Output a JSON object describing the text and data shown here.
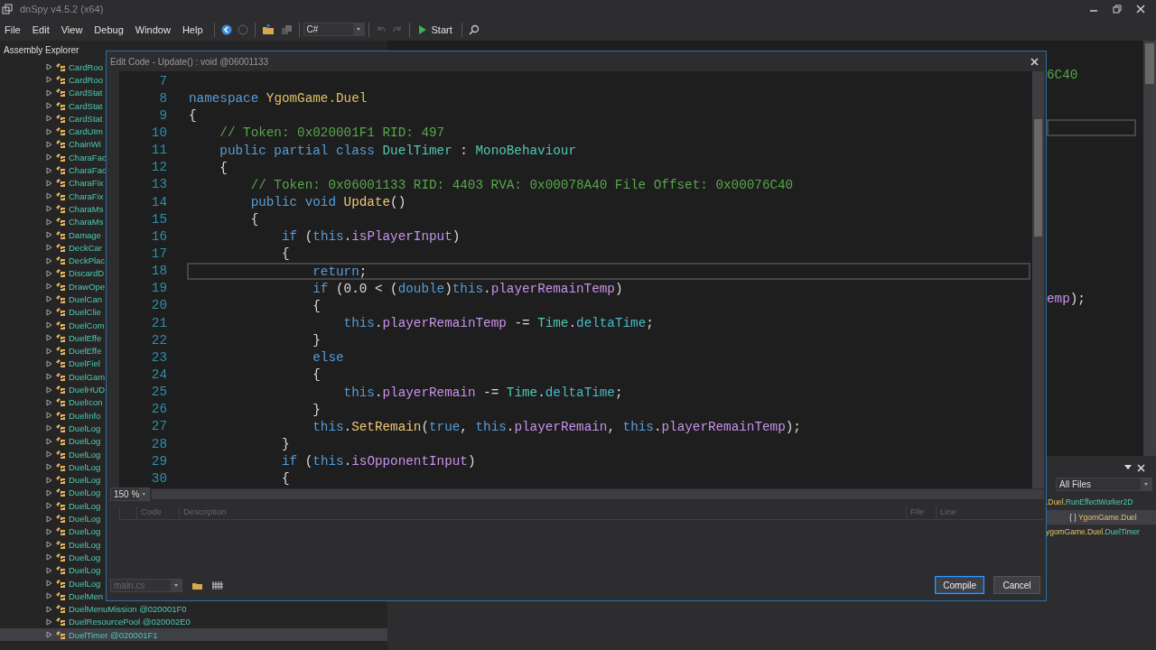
{
  "window": {
    "title": "dnSpy v4.5.2 (x64)"
  },
  "menu": [
    "File",
    "Edit",
    "View",
    "Debug",
    "Window",
    "Help"
  ],
  "toolbar": {
    "language": "C#",
    "start": "Start"
  },
  "assembly_explorer": {
    "title": "Assembly Explorer",
    "items": [
      {
        "label": "CardRoo",
        "selected": false
      },
      {
        "label": "CardRoo",
        "selected": false
      },
      {
        "label": "CardStat",
        "selected": false
      },
      {
        "label": "CardStat",
        "selected": false
      },
      {
        "label": "CardStat",
        "selected": false
      },
      {
        "label": "CardUIm",
        "selected": false
      },
      {
        "label": "ChainWi",
        "selected": false
      },
      {
        "label": "CharaFac",
        "selected": false
      },
      {
        "label": "CharaFac",
        "selected": false
      },
      {
        "label": "CharaFix",
        "selected": false
      },
      {
        "label": "CharaFix",
        "selected": false
      },
      {
        "label": "CharaMs",
        "selected": false
      },
      {
        "label": "CharaMs",
        "selected": false
      },
      {
        "label": "Damage",
        "selected": false
      },
      {
        "label": "DeckCar",
        "selected": false
      },
      {
        "label": "DeckPlac",
        "selected": false
      },
      {
        "label": "DiscardD",
        "selected": false
      },
      {
        "label": "DrawOpe",
        "selected": false
      },
      {
        "label": "DuelCan",
        "selected": false
      },
      {
        "label": "DuelClie",
        "selected": false
      },
      {
        "label": "DuelCom",
        "selected": false
      },
      {
        "label": "DuelEffe",
        "selected": false
      },
      {
        "label": "DuelEffe",
        "selected": false
      },
      {
        "label": "DuelFiel",
        "selected": false
      },
      {
        "label": "DuelGam",
        "selected": false
      },
      {
        "label": "DuelHUD",
        "selected": false
      },
      {
        "label": "DuelIcon",
        "selected": false
      },
      {
        "label": "DuelInfo",
        "selected": false
      },
      {
        "label": "DuelLog",
        "selected": false
      },
      {
        "label": "DuelLog",
        "selected": false
      },
      {
        "label": "DuelLog",
        "selected": false
      },
      {
        "label": "DuelLog",
        "selected": false
      },
      {
        "label": "DuelLog",
        "selected": false
      },
      {
        "label": "DuelLog",
        "selected": false
      },
      {
        "label": "DuelLog",
        "selected": false
      },
      {
        "label": "DuelLog",
        "selected": false
      },
      {
        "label": "DuelLog",
        "selected": false
      },
      {
        "label": "DuelLog",
        "selected": false
      },
      {
        "label": "DuelLog",
        "selected": false
      },
      {
        "label": "DuelLog",
        "selected": false
      },
      {
        "label": "DuelLog",
        "selected": false
      },
      {
        "label": "DuelMen",
        "selected": false
      },
      {
        "label": "DuelMenuMission @020001F0",
        "selected": false
      },
      {
        "label": "DuelResourcePool @020002E0",
        "selected": false
      },
      {
        "label": "DuelTimer @020001F1",
        "selected": true
      }
    ]
  },
  "editor": {
    "lines": [
      {
        "tokens": [
          {
            "kind": "comment",
            "text": "6C40"
          }
        ]
      },
      {
        "tokens": [
          {
            "kind": "field",
            "text": "emp"
          },
          {
            "kind": "plain",
            "text": ");"
          }
        ]
      }
    ]
  },
  "search_panel": {
    "filter": "All Files",
    "items": [
      {
        "selected": false,
        "tokens": [
          {
            "kind": "ns",
            "text": ".Duel."
          },
          {
            "kind": "type",
            "text": "RunEffectWorker2D"
          }
        ]
      },
      {
        "selected": true,
        "tokens": [
          {
            "kind": "plain",
            "text": "{ } "
          },
          {
            "kind": "ns",
            "text": "YgomGame.Duel"
          }
        ]
      },
      {
        "selected": false,
        "tokens": [
          {
            "kind": "ns",
            "text": "ygomGame.Duel."
          },
          {
            "kind": "type",
            "text": "DuelTimer"
          }
        ]
      }
    ]
  },
  "dialog": {
    "title": "Edit Code - Update() : void @06001133",
    "lines": [
      {
        "number": "7",
        "current": false
      },
      {
        "number": "8",
        "current": false,
        "tokens": [
          {
            "kind": "kw",
            "text": "namespace "
          },
          {
            "kind": "ns",
            "text": "YgomGame.Duel"
          }
        ]
      },
      {
        "number": "9",
        "current": false,
        "tokens": [
          {
            "kind": "plain",
            "text": "{"
          }
        ]
      },
      {
        "number": "10",
        "current": false,
        "tokens": [
          {
            "kind": "comment",
            "text": "    // Token: 0x020001F1 RID: 497"
          }
        ]
      },
      {
        "number": "11",
        "current": false,
        "tokens": [
          {
            "kind": "kw",
            "text": "    public partial class "
          },
          {
            "kind": "type",
            "text": "DuelTimer"
          },
          {
            "kind": "plain",
            "text": " : "
          },
          {
            "kind": "type",
            "text": "MonoBehaviour"
          }
        ]
      },
      {
        "number": "12",
        "current": false,
        "tokens": [
          {
            "kind": "plain",
            "text": "    {"
          }
        ]
      },
      {
        "number": "13",
        "current": false,
        "tokens": [
          {
            "kind": "comment",
            "text": "        // Token: 0x06001133 RID: 4403 RVA: 0x00078A40 File Offset: 0x00076C40"
          }
        ]
      },
      {
        "number": "14",
        "current": false,
        "tokens": [
          {
            "kind": "kw",
            "text": "        public void "
          },
          {
            "kind": "method",
            "text": "Update"
          },
          {
            "kind": "plain",
            "text": "()"
          }
        ]
      },
      {
        "number": "15",
        "current": false,
        "tokens": [
          {
            "kind": "plain",
            "text": "        {"
          }
        ]
      },
      {
        "number": "16",
        "current": false,
        "tokens": [
          {
            "kind": "kw",
            "text": "            if"
          },
          {
            "kind": "plain",
            "text": " ("
          },
          {
            "kind": "kw",
            "text": "this"
          },
          {
            "kind": "plain",
            "text": "."
          },
          {
            "kind": "field",
            "text": "isPlayerInput"
          },
          {
            "kind": "plain",
            "text": ")"
          }
        ]
      },
      {
        "number": "17",
        "current": false,
        "tokens": [
          {
            "kind": "plain",
            "text": "            {"
          }
        ]
      },
      {
        "number": "18",
        "current": true,
        "tokens": [
          {
            "kind": "kw",
            "text": "                return"
          },
          {
            "kind": "plain",
            "text": ";"
          }
        ]
      },
      {
        "number": "19",
        "current": false,
        "tokens": [
          {
            "kind": "kw",
            "text": "                if"
          },
          {
            "kind": "plain",
            "text": " (0.0 < ("
          },
          {
            "kind": "kw",
            "text": "double"
          },
          {
            "kind": "plain",
            "text": ")"
          },
          {
            "kind": "kw",
            "text": "this"
          },
          {
            "kind": "plain",
            "text": "."
          },
          {
            "kind": "field",
            "text": "playerRemainTemp"
          },
          {
            "kind": "plain",
            "text": ")"
          }
        ]
      },
      {
        "number": "20",
        "current": false,
        "tokens": [
          {
            "kind": "plain",
            "text": "                {"
          }
        ]
      },
      {
        "number": "21",
        "current": false,
        "tokens": [
          {
            "kind": "kw",
            "text": "                    this"
          },
          {
            "kind": "plain",
            "text": "."
          },
          {
            "kind": "field",
            "text": "playerRemainTemp"
          },
          {
            "kind": "plain",
            "text": " -= "
          },
          {
            "kind": "type",
            "text": "Time"
          },
          {
            "kind": "plain",
            "text": "."
          },
          {
            "kind": "property",
            "text": "deltaTime"
          },
          {
            "kind": "plain",
            "text": ";"
          }
        ]
      },
      {
        "number": "22",
        "current": false,
        "tokens": [
          {
            "kind": "plain",
            "text": "                }"
          }
        ]
      },
      {
        "number": "23",
        "current": false,
        "tokens": [
          {
            "kind": "kw",
            "text": "                else"
          }
        ]
      },
      {
        "number": "24",
        "current": false,
        "tokens": [
          {
            "kind": "plain",
            "text": "                {"
          }
        ]
      },
      {
        "number": "25",
        "current": false,
        "tokens": [
          {
            "kind": "kw",
            "text": "                    this"
          },
          {
            "kind": "plain",
            "text": "."
          },
          {
            "kind": "field",
            "text": "playerRemain"
          },
          {
            "kind": "plain",
            "text": " -= "
          },
          {
            "kind": "type",
            "text": "Time"
          },
          {
            "kind": "plain",
            "text": "."
          },
          {
            "kind": "property",
            "text": "deltaTime"
          },
          {
            "kind": "plain",
            "text": ";"
          }
        ]
      },
      {
        "number": "26",
        "current": false,
        "tokens": [
          {
            "kind": "plain",
            "text": "                }"
          }
        ]
      },
      {
        "number": "27",
        "current": false,
        "tokens": [
          {
            "kind": "kw",
            "text": "                this"
          },
          {
            "kind": "plain",
            "text": "."
          },
          {
            "kind": "method",
            "text": "SetRemain"
          },
          {
            "kind": "plain",
            "text": "("
          },
          {
            "kind": "kw",
            "text": "true"
          },
          {
            "kind": "plain",
            "text": ", "
          },
          {
            "kind": "kw",
            "text": "this"
          },
          {
            "kind": "plain",
            "text": "."
          },
          {
            "kind": "field",
            "text": "playerRemain"
          },
          {
            "kind": "plain",
            "text": ", "
          },
          {
            "kind": "kw",
            "text": "this"
          },
          {
            "kind": "plain",
            "text": "."
          },
          {
            "kind": "field",
            "text": "playerRemainTemp"
          },
          {
            "kind": "plain",
            "text": ");"
          }
        ]
      },
      {
        "number": "28",
        "current": false,
        "tokens": [
          {
            "kind": "plain",
            "text": "            }"
          }
        ]
      },
      {
        "number": "29",
        "current": false,
        "tokens": [
          {
            "kind": "kw",
            "text": "            if"
          },
          {
            "kind": "plain",
            "text": " ("
          },
          {
            "kind": "kw",
            "text": "this"
          },
          {
            "kind": "plain",
            "text": "."
          },
          {
            "kind": "field",
            "text": "isOpponentInput"
          },
          {
            "kind": "plain",
            "text": ")"
          }
        ]
      },
      {
        "number": "30",
        "current": false,
        "tokens": [
          {
            "kind": "plain",
            "text": "            {"
          }
        ]
      }
    ],
    "zoom": "150 %",
    "error_columns": [
      "Code",
      "Description",
      "File",
      "Line"
    ],
    "file": "main.cs",
    "buttons": [
      {
        "label": "Compile",
        "focused": true
      },
      {
        "label": "Cancel",
        "focused": false
      }
    ]
  }
}
